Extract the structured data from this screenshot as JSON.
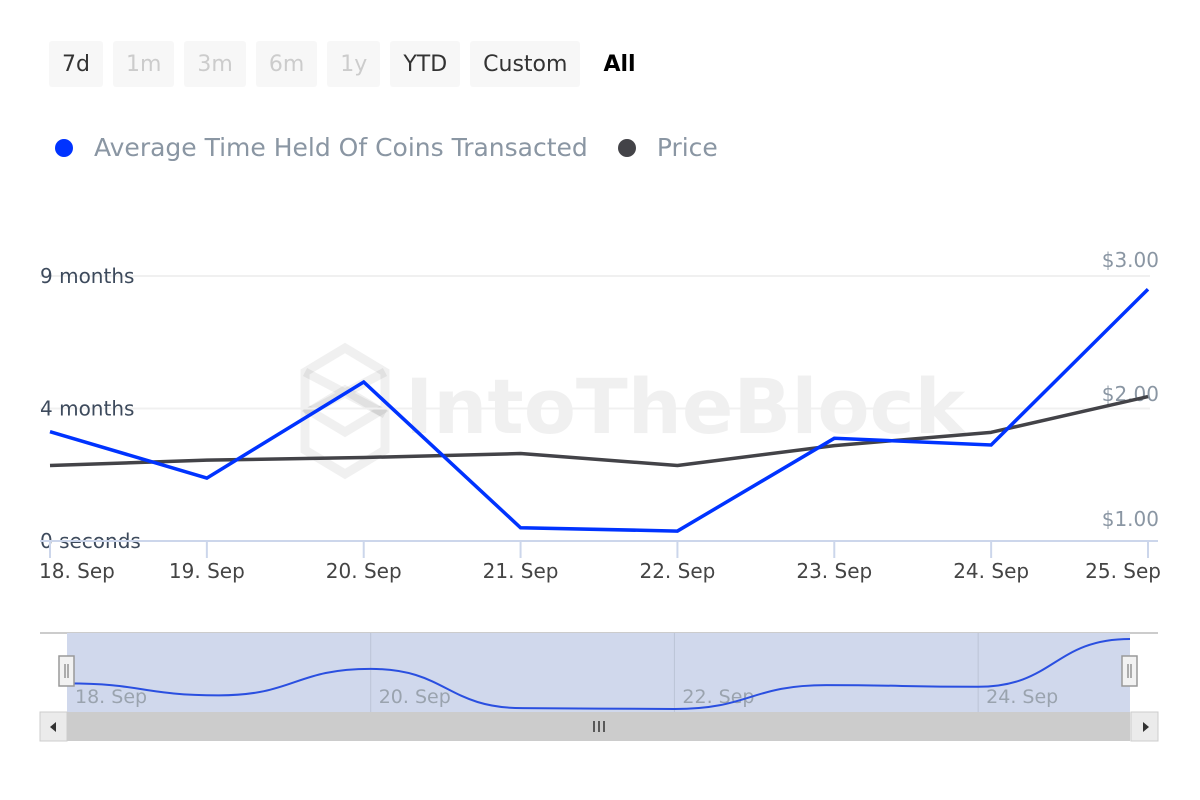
{
  "range_selector": {
    "buttons": [
      {
        "label": "7d",
        "state": "enabled"
      },
      {
        "label": "1m",
        "state": "disabled"
      },
      {
        "label": "3m",
        "state": "disabled"
      },
      {
        "label": "6m",
        "state": "disabled"
      },
      {
        "label": "1y",
        "state": "disabled"
      },
      {
        "label": "YTD",
        "state": "enabled"
      },
      {
        "label": "Custom",
        "state": "enabled"
      },
      {
        "label": "All",
        "state": "active"
      }
    ]
  },
  "colors": {
    "series_time_held": "#0033ff",
    "series_price": "#434348",
    "navigator_mask": "#d0d8ec",
    "scrollbar": "#cccccc"
  },
  "watermark": "IntoTheBlock",
  "chart_data": {
    "type": "line",
    "title": "",
    "x": [
      "18. Sep",
      "19. Sep",
      "20. Sep",
      "21. Sep",
      "22. Sep",
      "23. Sep",
      "24. Sep",
      "25. Sep"
    ],
    "series": [
      {
        "name": "Average Time Held Of Coins Transacted",
        "axis": "left",
        "unit": "months",
        "values": [
          3.3,
          1.9,
          5.0,
          0.4,
          0.3,
          3.1,
          2.9,
          8.5
        ]
      },
      {
        "name": "Price",
        "axis": "right",
        "unit": "USD",
        "values": [
          1.57,
          1.61,
          1.63,
          1.66,
          1.57,
          1.72,
          1.82,
          2.09
        ]
      }
    ],
    "left_axis": {
      "tick_labels": [
        "0 seconds",
        "4 months",
        "9 months"
      ],
      "tick_values": [
        0,
        4,
        9
      ]
    },
    "right_axis": {
      "tick_labels": [
        "$1.00",
        "$2.00",
        "$3.00"
      ],
      "tick_values": [
        1,
        2,
        3
      ],
      "ylim": [
        1,
        3
      ]
    },
    "grid": true,
    "legend": "top-left",
    "navigator": {
      "x_tick_labels": [
        "18. Sep",
        "20. Sep",
        "22. Sep",
        "24. Sep"
      ],
      "selected_range": [
        "18. Sep",
        "25. Sep"
      ]
    }
  }
}
